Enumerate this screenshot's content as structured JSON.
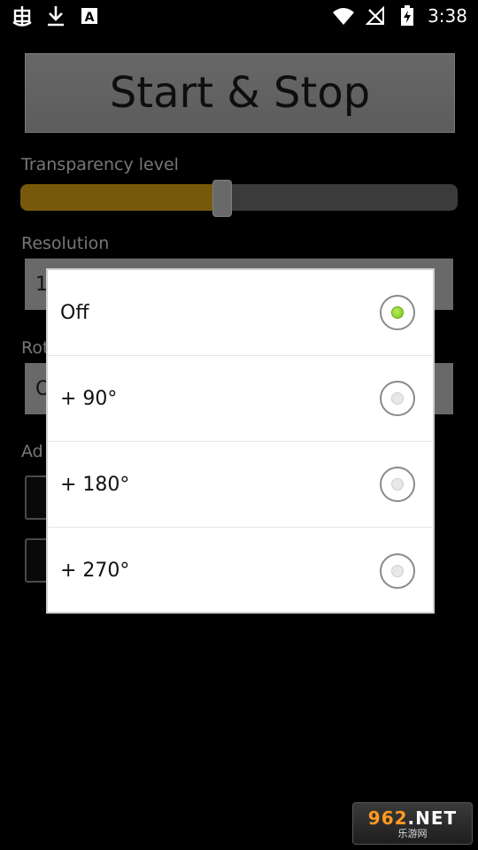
{
  "status_bar": {
    "time": "3:38",
    "left_icons": [
      "bug-icon",
      "download-icon",
      "font-a-icon"
    ],
    "right_icons": [
      "wifi-icon",
      "no-signal-icon",
      "battery-icon"
    ],
    "font_icon_letter": "A"
  },
  "app": {
    "start_stop_label": "Start & Stop",
    "transparency_label": "Transparency level",
    "transparency_value": 0.46,
    "resolution_label": "Resolution",
    "resolution_value": "1",
    "rotation_label": "Rot",
    "rotation_value": "O",
    "ads_label": "Ad"
  },
  "dialog": {
    "options": [
      {
        "label": "Off",
        "selected": true
      },
      {
        "label": "+ 90°",
        "selected": false
      },
      {
        "label": "+ 180°",
        "selected": false
      },
      {
        "label": "+ 270°",
        "selected": false
      }
    ]
  },
  "watermark": {
    "top_number": "962",
    "top_suffix": ".NET",
    "bottom": "乐游网"
  },
  "colors": {
    "slider_fill": "#d9a316",
    "radio_selected": "#74c21c",
    "background": "#000000"
  }
}
